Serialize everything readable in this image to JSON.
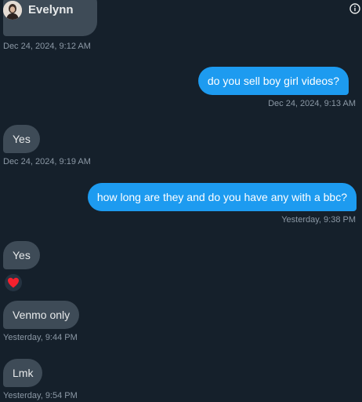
{
  "conversation": {
    "contact_name": "Evelynn"
  },
  "messages": [
    {
      "direction": "in",
      "text": "",
      "timestamp": "Dec 24, 2024, 9:12 AM"
    },
    {
      "direction": "out",
      "text": "do you sell boy girl videos?",
      "timestamp": "Dec 24, 2024, 9:13 AM"
    },
    {
      "direction": "in",
      "text": "Yes",
      "timestamp": "Dec 24, 2024, 9:19 AM"
    },
    {
      "direction": "out",
      "text": "how long are they and do you have any with a bbc?",
      "timestamp": "Yesterday, 9:38 PM"
    },
    {
      "direction": "in",
      "text": "Yes",
      "reaction": "heart"
    },
    {
      "direction": "in",
      "text": "Venmo only",
      "timestamp": "Yesterday, 9:44 PM"
    },
    {
      "direction": "in",
      "text": "Lmk",
      "timestamp": "Yesterday, 9:54 PM"
    }
  ],
  "colors": {
    "background": "#15202b",
    "incoming_bubble": "#3e4b57",
    "outgoing_bubble": "#1d9bf0",
    "timestamp": "#8b98a5",
    "reaction_heart": "#f4212e"
  }
}
